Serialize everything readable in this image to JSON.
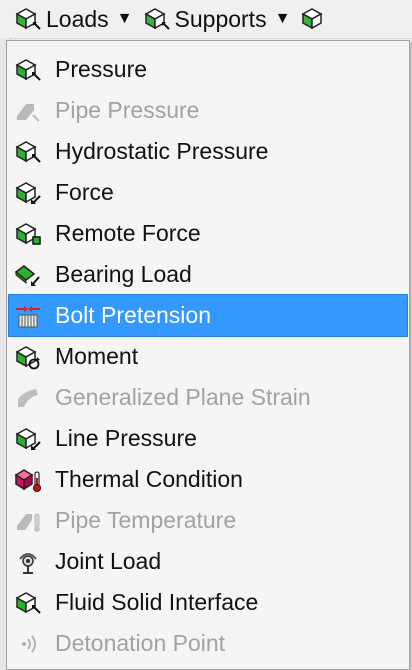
{
  "toolbar": {
    "loads_label": "Loads",
    "supports_label": "Supports"
  },
  "menu": {
    "items": [
      {
        "label": "Pressure",
        "icon": "pressure-icon",
        "enabled": true
      },
      {
        "label": "Pipe Pressure",
        "icon": "pipe-pressure-icon",
        "enabled": false
      },
      {
        "label": "Hydrostatic Pressure",
        "icon": "hydrostatic-pressure-icon",
        "enabled": true
      },
      {
        "label": "Force",
        "icon": "force-icon",
        "enabled": true
      },
      {
        "label": "Remote Force",
        "icon": "remote-force-icon",
        "enabled": true
      },
      {
        "label": "Bearing Load",
        "icon": "bearing-load-icon",
        "enabled": true
      },
      {
        "label": "Bolt Pretension",
        "icon": "bolt-pretension-icon",
        "enabled": true,
        "highlighted": true
      },
      {
        "label": "Moment",
        "icon": "moment-icon",
        "enabled": true
      },
      {
        "label": "Generalized Plane Strain",
        "icon": "generalized-plane-strain-icon",
        "enabled": false
      },
      {
        "label": "Line Pressure",
        "icon": "line-pressure-icon",
        "enabled": true
      },
      {
        "label": "Thermal Condition",
        "icon": "thermal-condition-icon",
        "enabled": true
      },
      {
        "label": "Pipe Temperature",
        "icon": "pipe-temperature-icon",
        "enabled": false
      },
      {
        "label": "Joint Load",
        "icon": "joint-load-icon",
        "enabled": true
      },
      {
        "label": "Fluid Solid Interface",
        "icon": "fluid-solid-interface-icon",
        "enabled": true
      },
      {
        "label": "Detonation Point",
        "icon": "detonation-point-icon",
        "enabled": false
      }
    ]
  },
  "colors": {
    "highlight": "#3399ff",
    "disabled_text": "#a2a2a2",
    "cube_green": "#2fae2f",
    "thermal_magenta": "#d0105a"
  }
}
